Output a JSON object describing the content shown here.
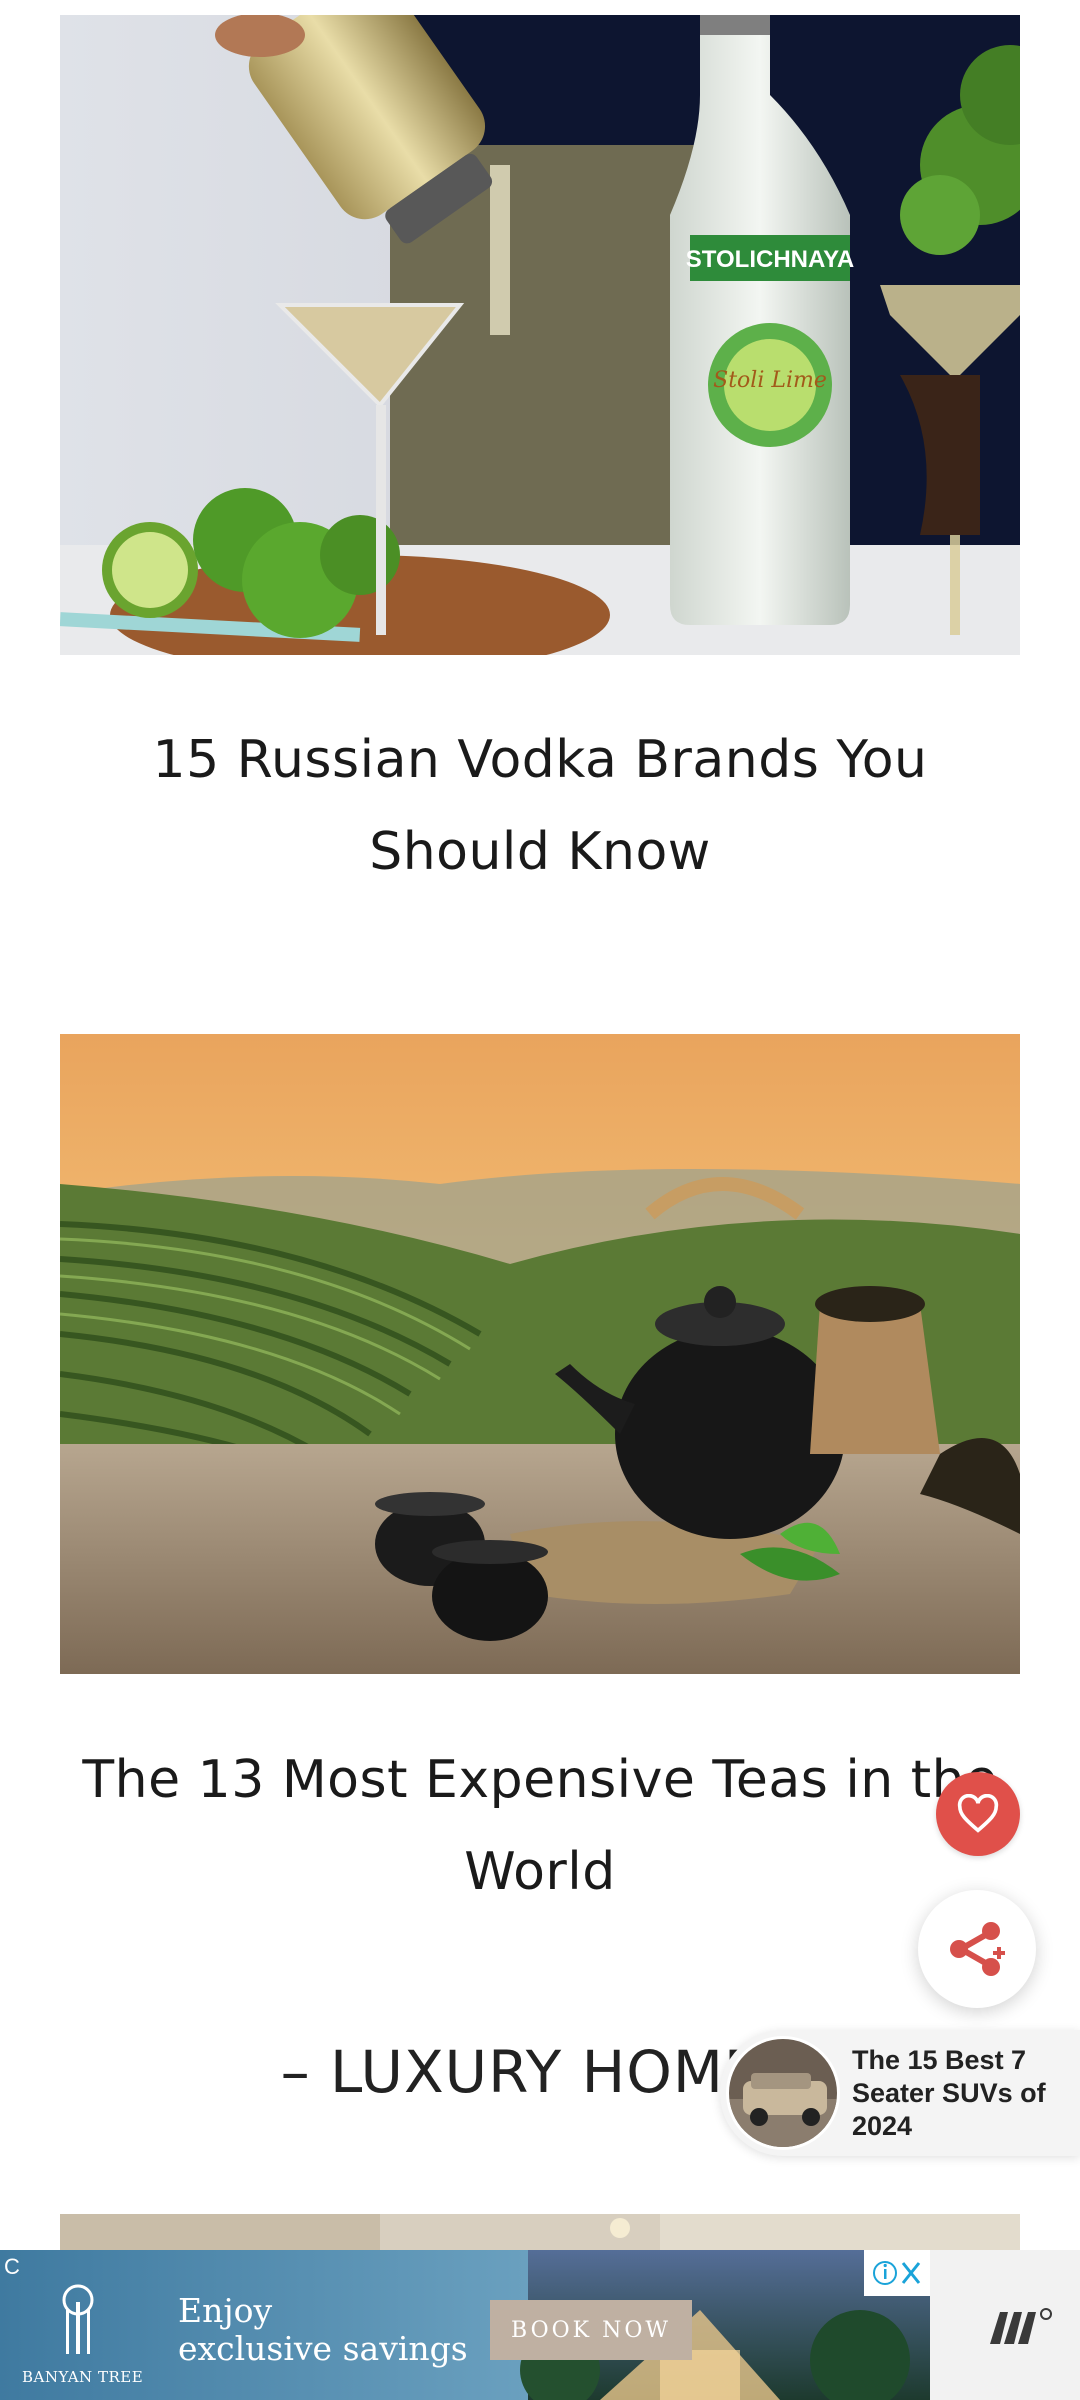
{
  "articles": [
    {
      "title": "15 Russian Vodka Brands You Should Know",
      "image_label": "STOLICHNAYA",
      "image_sub_label": "Stoli Lime"
    },
    {
      "title": "The 13 Most Expensive Teas in the World"
    }
  ],
  "section_heading": "– LUXURY HOMES",
  "floating": {
    "favorite_icon": "heart-icon",
    "share_icon": "share-icon"
  },
  "promo": {
    "title": "The 15 Best 7 Seater SUVs of 2024"
  },
  "ad": {
    "brand": "BANYAN TREE",
    "headline_line1": "Enjoy",
    "headline_line2": "exclusive savings",
    "cta": "BOOK NOW",
    "corner_mark": "C"
  },
  "colors": {
    "accent": "#e0504a",
    "ad_blue": "#4e86a8",
    "ad_button": "#bfb0a2"
  }
}
